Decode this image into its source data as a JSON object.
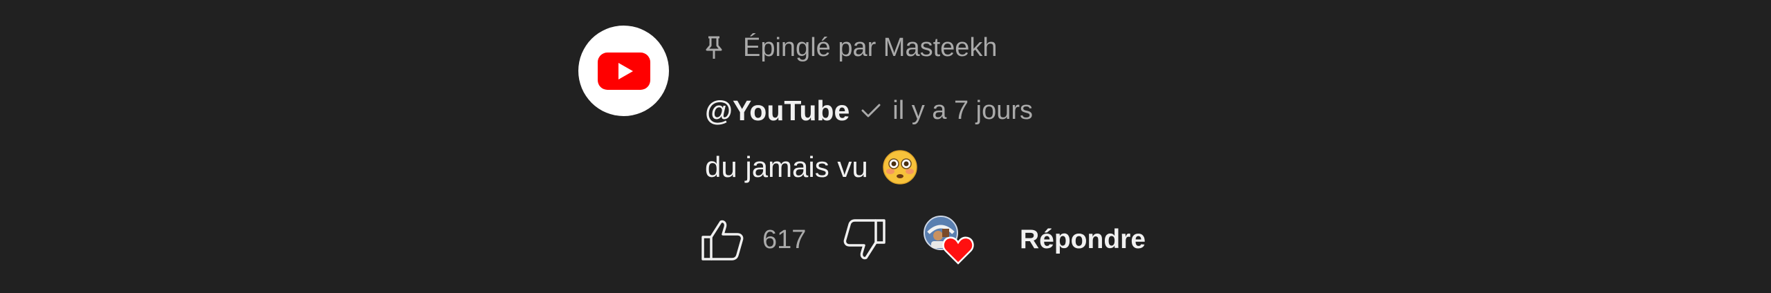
{
  "comment": {
    "pinned_label": "Épinglé par Masteekh",
    "author": "@YouTube",
    "timestamp": "il y a 7 jours",
    "text": "du jamais vu",
    "like_count": "617",
    "reply_label": "Répondre"
  },
  "icons": {
    "pin": "pin-icon",
    "verified": "checkmark-icon",
    "emoji": "flushed-face-emoji",
    "like": "thumbs-up-icon",
    "dislike": "thumbs-down-icon",
    "heart": "creator-heart-icon"
  },
  "colors": {
    "background": "#212121",
    "youtube_red": "#ff0000",
    "secondary_text": "#aaaaaa",
    "primary_text": "#f1f1f1"
  }
}
